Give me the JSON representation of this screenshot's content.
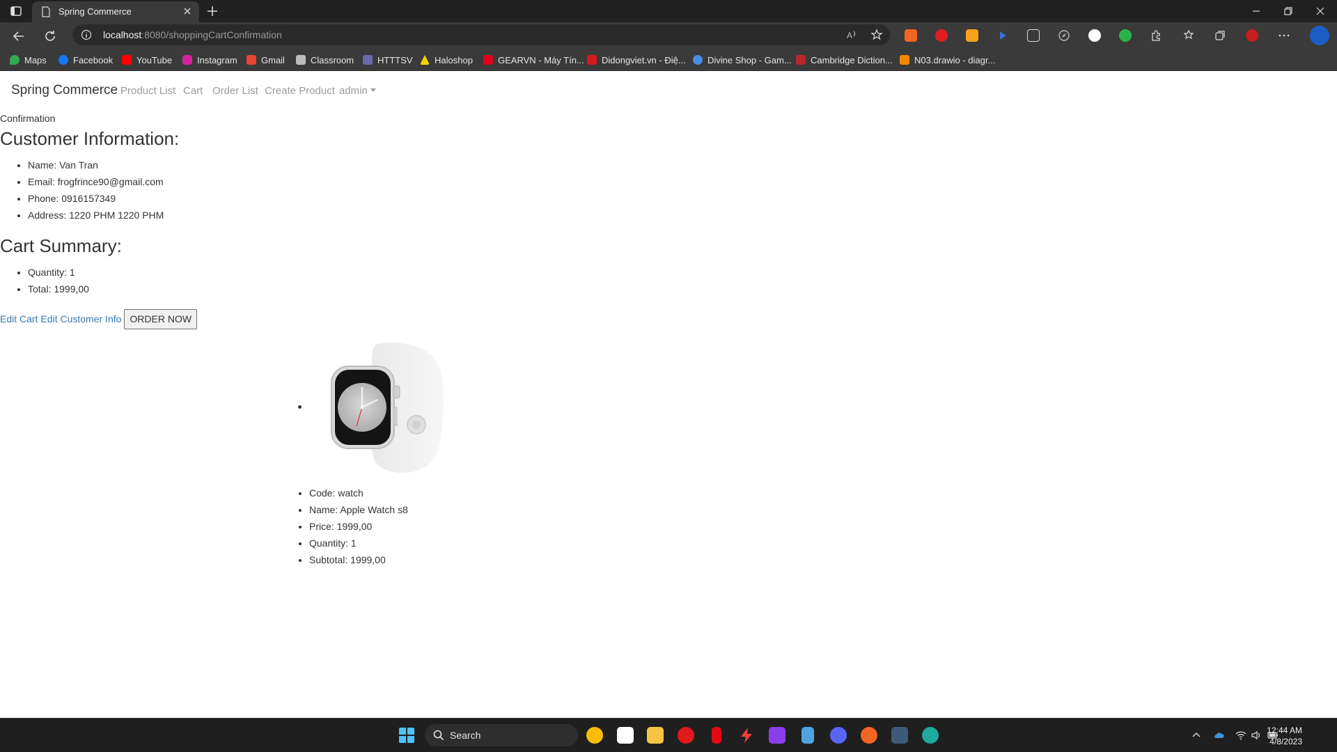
{
  "browser": {
    "tab_title": "Spring Commerce",
    "url_host": "localhost",
    "url_path": ":8080/shoppingCartConfirmation",
    "bookmarks": [
      "Maps",
      "Facebook",
      "YouTube",
      "Instagram",
      "Gmail",
      "Classroom",
      "HTTTSV",
      "Haloshop",
      "GEARVN - Máy Tín...",
      "Didongviet.vn - Điệ...",
      "Divine Shop - Gam...",
      "Cambridge Diction...",
      "N03.drawio - diagr..."
    ]
  },
  "navbar": {
    "brand": "Spring Commerce",
    "links": [
      "Product List",
      "Cart",
      "Order List",
      "Create Product"
    ],
    "user": "admin"
  },
  "page": {
    "breadcrumb": "Confirmation",
    "customer_heading": "Customer Information:",
    "customer": {
      "name": "Name: Van Tran",
      "email": "Email: frogfrince90@gmail.com",
      "phone": "Phone: 0916157349",
      "address": "Address: 1220 PHM 1220 PHM"
    },
    "cart_heading": "Cart Summary:",
    "cart": {
      "quantity": "Quantity: 1",
      "total": "Total: 1999,00"
    },
    "actions": {
      "edit_cart": "Edit Cart",
      "edit_customer": "Edit Customer Info",
      "order_now": "ORDER NOW"
    },
    "product": {
      "code": "Code: watch",
      "name": "Name: Apple Watch s8",
      "price": "Price: 1999,00",
      "quantity": "Quantity: 1",
      "subtotal": "Subtotal: 1999,00"
    }
  },
  "taskbar": {
    "search_label": "Search",
    "time": "12:44 AM",
    "date": "4/8/2023"
  }
}
